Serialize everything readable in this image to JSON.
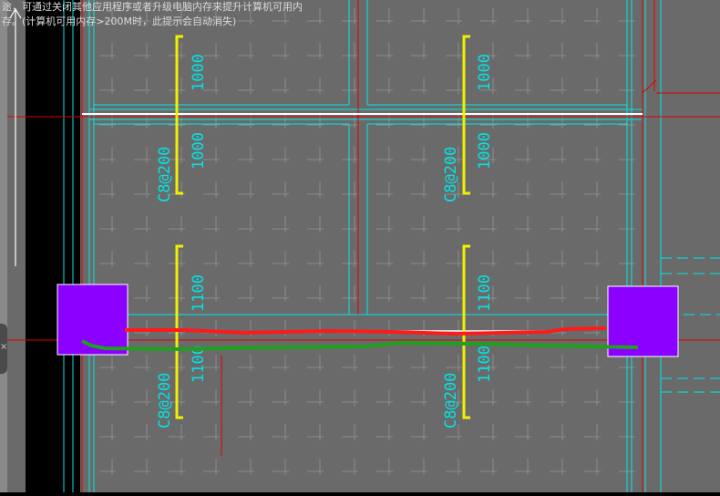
{
  "notice": {
    "line1": "途，可通过关闭其他应用程序或者升级电脑内存来提升计算机可用内",
    "line2": "存。(计算机可用内存>200M时，此提示会自动消失)"
  },
  "rebar_labels": {
    "top_left_upper": "1000",
    "top_left_lower": "1000",
    "top_left_spec": "C8@200",
    "top_right_upper": "1000",
    "top_right_lower": "1000",
    "top_right_spec": "C8@200",
    "bottom_left_upper": "1100",
    "bottom_left_lower": "1100",
    "bottom_left_spec": "C8@200",
    "bottom_right_upper": "1100",
    "bottom_right_lower": "1100",
    "bottom_right_spec": "C8@200"
  },
  "colors": {
    "canvas": "#6a6a6a",
    "grid": "#8c8c8c",
    "cyan": "#00e5e5",
    "rebar": "#f0f000",
    "axis": "#e00000",
    "column": "#8b00ff",
    "green_stroke": "#1fa01f",
    "red_stroke": "#ff1a1a"
  },
  "icons": {
    "ucs": "ucs-axis-icon",
    "collapse": "collapse-tab-icon"
  }
}
